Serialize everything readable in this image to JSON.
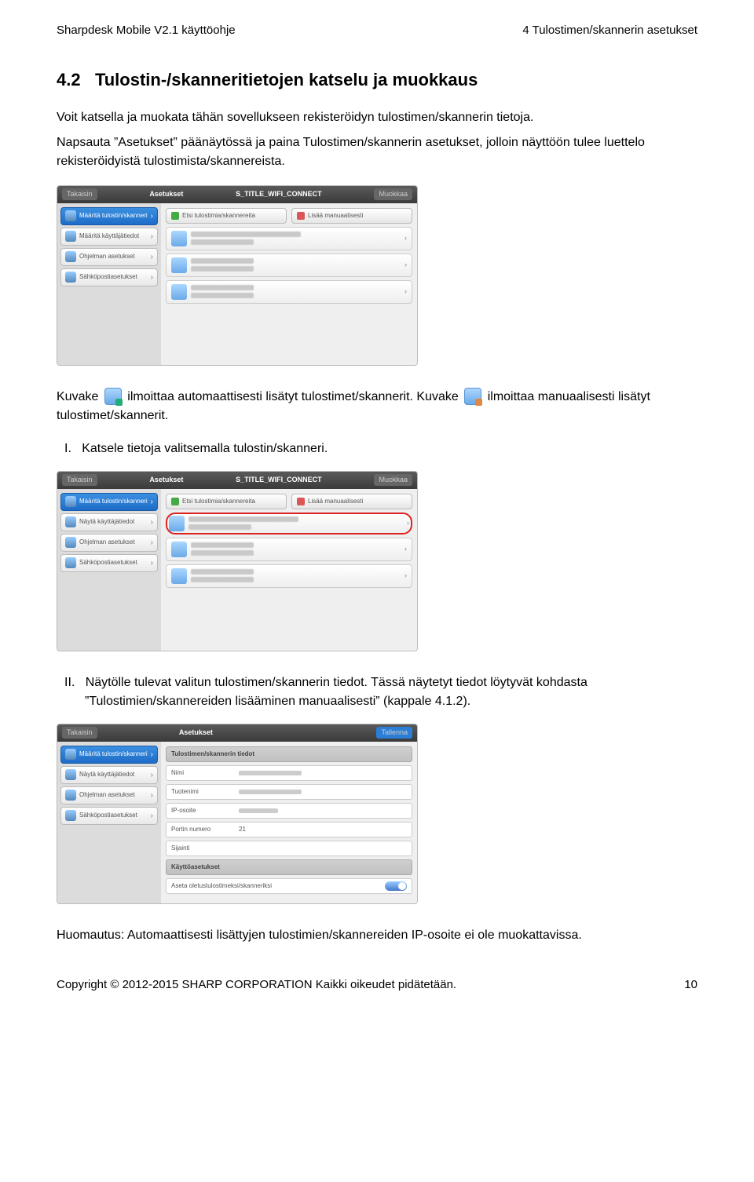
{
  "header": {
    "left": "Sharpdesk Mobile V2.1 käyttöohje",
    "right": "4 Tulostimen/skannerin asetukset"
  },
  "section": {
    "num": "4.2",
    "title": "Tulostin-/skanneritietojen katselu ja muokkaus"
  },
  "para1": "Voit katsella ja muokata tähän sovellukseen rekisteröidyn tulostimen/skannerin tietoja.",
  "para2": "Napsauta ”Asetukset” päänäytössä ja paina Tulostimen/skannerin asetukset, jolloin näyttöön tulee luettelo rekisteröidyistä tulostimista/skannereista.",
  "shot1": {
    "back": "Takaisin",
    "title": "Asetukset",
    "center": "S_TITLE_WIFI_CONNECT",
    "edit": "Muokkaa",
    "side": [
      "Määritä tulostin/skanneri",
      "Määritä käyttäjätiedot",
      "Ohjelman asetukset",
      "Sähköpostiasetukset"
    ],
    "btn1": "Etsi tulostimia/skannereita",
    "btn2": "Lisää manuaalisesti"
  },
  "iconline_a": "Kuvake",
  "iconline_b": "ilmoittaa automaattisesti lisätyt tulostimet/skannerit. Kuvake",
  "iconline_c": "ilmoittaa manuaalisesti lisätyt tulostimet/skannerit.",
  "romanI_num": "I.",
  "romanI_text": "Katsele tietoja valitsemalla tulostin/skanneri.",
  "shot2": {
    "back": "Takaisin",
    "title": "Asetukset",
    "center": "S_TITLE_WIFI_CONNECT",
    "edit": "Muokkaa",
    "side": [
      "Määritä tulostin/skanneri",
      "Näytä käyttäjätiedot",
      "Ohjelman asetukset",
      "Sähköpostiasetukset"
    ],
    "btn1": "Etsi tulostimia/skannereita",
    "btn2": "Lisää manuaalisesti"
  },
  "romanII_num": "II.",
  "romanII_text": "Näytölle tulevat valitun tulostimen/skannerin tiedot. Tässä näytetyt tiedot löytyvät kohdasta ”Tulostimien/skannereiden lisääminen manuaalisesti” (kappale 4.1.2).",
  "shot3": {
    "back": "Takaisin",
    "title": "Asetukset",
    "save": "Tallenna",
    "side": [
      "Määritä tulostin/skanneri",
      "Näytä käyttäjätiedot",
      "Ohjelman asetukset",
      "Sähköpostiasetukset"
    ],
    "dhead1": "Tulostimen/skannerin tiedot",
    "rows": [
      "Nimi",
      "Tuotenimi",
      "IP-osoite",
      "Portin numero",
      "Sijainti"
    ],
    "portval": "21",
    "dhead2": "Käyttöasetukset",
    "row2": "Aseta oletustulostimeksi/skanneriksi"
  },
  "note": "Huomautus: Automaattisesti lisättyjen tulostimien/skannereiden IP-osoite ei ole muokattavissa.",
  "footer": {
    "left": "Copyright © 2012-2015 SHARP CORPORATION Kaikki oikeudet pidätetään.",
    "right": "10"
  }
}
